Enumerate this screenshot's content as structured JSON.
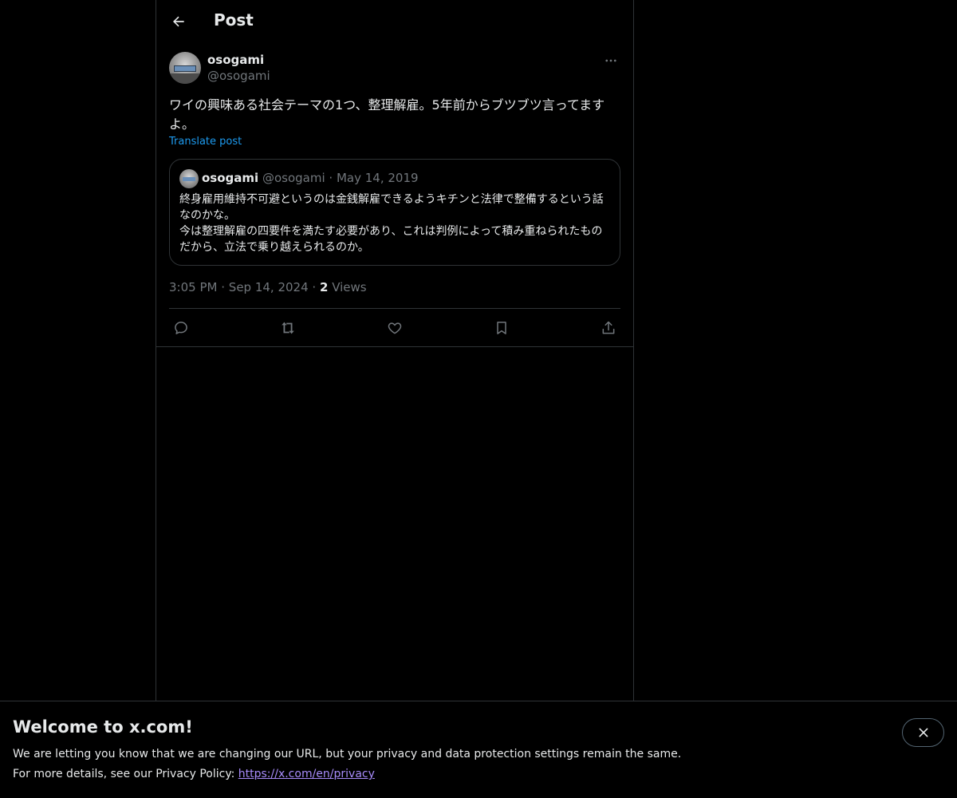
{
  "header": {
    "title": "Post"
  },
  "post": {
    "author_name": "osogami",
    "author_handle": "@osogami",
    "text": "ワイの興味ある社会テーマの1つ、整理解雇。5年前からブツブツ言ってますよ。",
    "translate_label": "Translate post",
    "time": "3:05 PM",
    "date": "Sep 14, 2024",
    "views_count": "2",
    "views_label": "Views",
    "separator": "·"
  },
  "quote": {
    "author_name": "osogami",
    "author_handle": "@osogami",
    "date": "May 14, 2019",
    "separator": "·",
    "text": "終身雇用維持不可避というのは金銭解雇できるようキチンと法律で整備するという話なのかな。\n今は整理解雇の四要件を満たす必要があり、これは判例によって積み重ねられたものだから、立法で乗り越えられるのか。"
  },
  "actions": {
    "icons": [
      "reply-icon",
      "repost-icon",
      "like-icon",
      "bookmark-icon",
      "share-icon"
    ]
  },
  "banner": {
    "title": "Welcome to x.com!",
    "line1": "We are letting you know that we are changing our URL, but your privacy and data protection settings remain the same.",
    "line2_prefix": "For more details, see our Privacy Policy: ",
    "link_text": "https://x.com/en/privacy"
  },
  "colors": {
    "background": "#000000",
    "text": "#e7e9ea",
    "muted": "#71767b",
    "accent": "#1d9bf0",
    "border": "#2f3336",
    "link_visited": "#a78bfa"
  }
}
